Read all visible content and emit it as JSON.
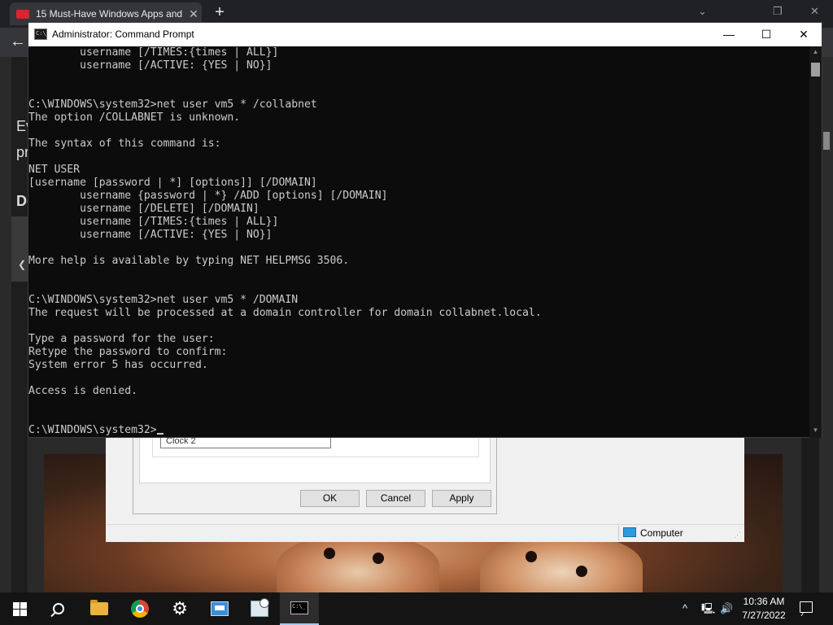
{
  "browser": {
    "tab_title": "15 Must-Have Windows Apps and",
    "tab_close": "✕",
    "new_tab": "+",
    "back": "←",
    "page_fragments": [
      "Ev",
      "pr",
      "Do"
    ]
  },
  "bg_dialog": {
    "clock_field": "Clock 2",
    "ok_label": "OK",
    "cancel_label": "Cancel",
    "apply_label": "Apply",
    "status_text": "Computer"
  },
  "cmd": {
    "title": "Administrator: Command Prompt",
    "icon_text": "C:\\_",
    "minimize": "—",
    "maximize": "☐",
    "close": "✕",
    "lines": [
      "        username [/TIMES:{times | ALL}]",
      "        username [/ACTIVE: {YES | NO}]",
      "",
      "",
      "C:\\WINDOWS\\system32>net user vm5 * /collabnet",
      "The option /COLLABNET is unknown.",
      "",
      "The syntax of this command is:",
      "",
      "NET USER",
      "[username [password | *] [options]] [/DOMAIN]",
      "        username {password | *} /ADD [options] [/DOMAIN]",
      "        username [/DELETE] [/DOMAIN]",
      "        username [/TIMES:{times | ALL}]",
      "        username [/ACTIVE: {YES | NO}]",
      "",
      "More help is available by typing NET HELPMSG 3506.",
      "",
      "",
      "C:\\WINDOWS\\system32>net user vm5 * /DOMAIN",
      "The request will be processed at a domain controller for domain collabnet.local.",
      "",
      "Type a password for the user:",
      "Retype the password to confirm:",
      "System error 5 has occurred.",
      "",
      "Access is denied.",
      "",
      "",
      "C:\\WINDOWS\\system32>"
    ]
  },
  "taskbar": {
    "time": "10:36 AM",
    "date": "7/27/2022",
    "tray_chevron": "^",
    "volume": "🔊"
  }
}
